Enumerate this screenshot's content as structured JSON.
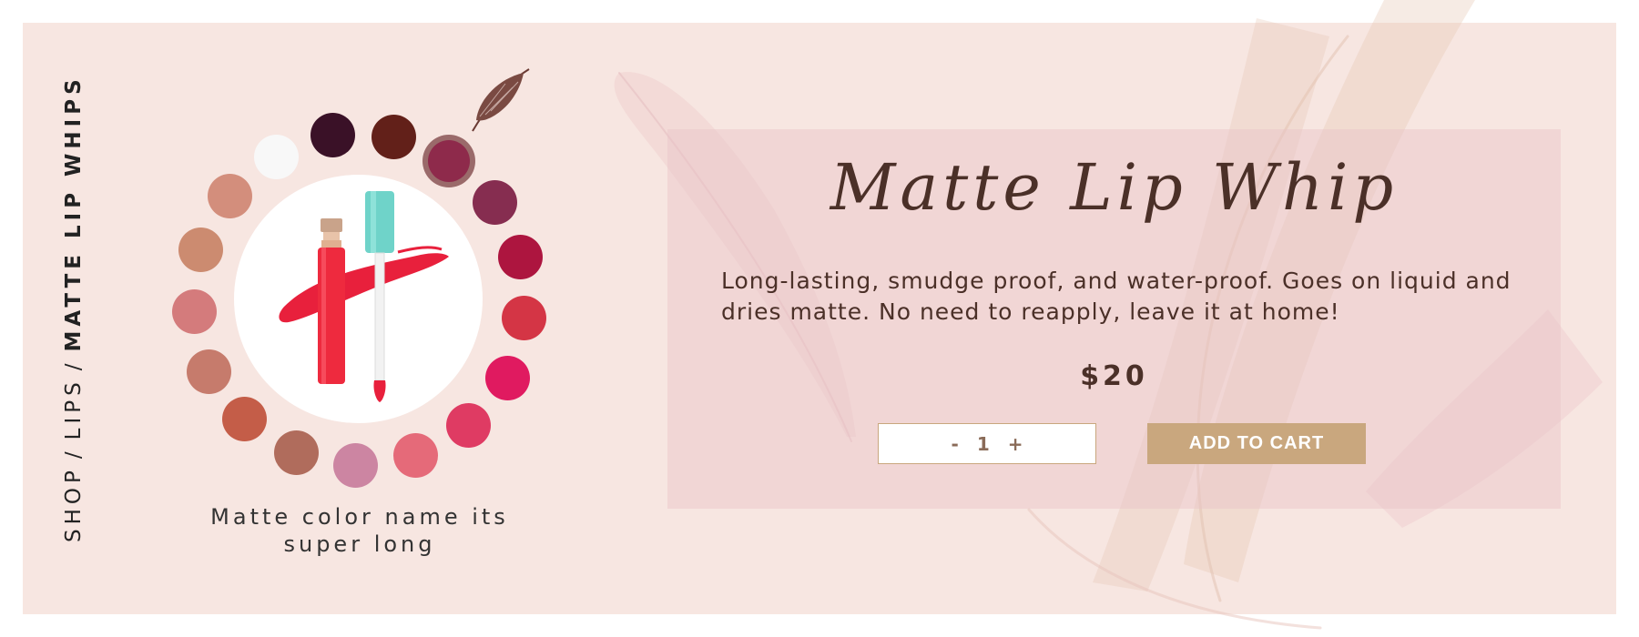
{
  "breadcrumb": {
    "shop": "SHOP",
    "lips": "LIPS",
    "current": "MATTE LIP WHIPS",
    "separator": "/"
  },
  "swatches": [
    {
      "color": "#f8f8f8"
    },
    {
      "color": "#3a1127"
    },
    {
      "color": "#622019"
    },
    {
      "color": "#8e2a4b",
      "selected": true
    },
    {
      "color": "#862d50"
    },
    {
      "color": "#ad153f"
    },
    {
      "color": "#d43545"
    },
    {
      "color": "#e01a60"
    },
    {
      "color": "#df3b63"
    },
    {
      "color": "#e56a79"
    },
    {
      "color": "#cc85a2"
    },
    {
      "color": "#b06c5c"
    },
    {
      "color": "#c45d48"
    },
    {
      "color": "#c67b6c"
    },
    {
      "color": "#d47b7c"
    },
    {
      "color": "#cc8b70"
    },
    {
      "color": "#d38e7c"
    }
  ],
  "color_name": "Matte color name its super long",
  "product": {
    "title": "Matte Lip Whip",
    "description": "Long-lasting, smudge proof, and water-proof. Goes on liquid and dries matte. No need to reapply, leave it at home!",
    "price": "$20"
  },
  "quantity": {
    "minus": "-",
    "value": "1",
    "plus": "+"
  },
  "add_to_cart": "ADD TO CART"
}
